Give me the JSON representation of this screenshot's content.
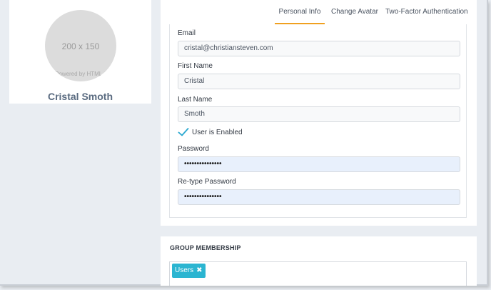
{
  "profile": {
    "avatar_placeholder": "200 x 150",
    "avatar_credit": "Powered by HTML.COM",
    "name": "Cristal Smoth"
  },
  "tabs": [
    {
      "label": "Personal Info",
      "active": true
    },
    {
      "label": "Change Avatar",
      "active": false
    },
    {
      "label": "Two-Factor Authentication",
      "active": false
    }
  ],
  "form": {
    "email_label": "Email",
    "email_value": "cristal@christiansteven.com",
    "first_name_label": "First Name",
    "first_name_value": "Cristal",
    "last_name_label": "Last Name",
    "last_name_value": "Smoth",
    "enabled_label": "User is Enabled",
    "enabled_checked": true,
    "password_label": "Password",
    "password_value": "•••••••••••••••",
    "retype_label": "Re-type Password",
    "retype_value": "•••••••••••••••"
  },
  "group": {
    "title": "GROUP MEMBERSHIP",
    "tags": [
      {
        "label": "Users",
        "remove_icon": "✖"
      }
    ]
  },
  "colors": {
    "accent_tab": "#f0a020",
    "check": "#2aa8d0",
    "tag": "#2bb5d1",
    "background": "#e9edf2"
  }
}
